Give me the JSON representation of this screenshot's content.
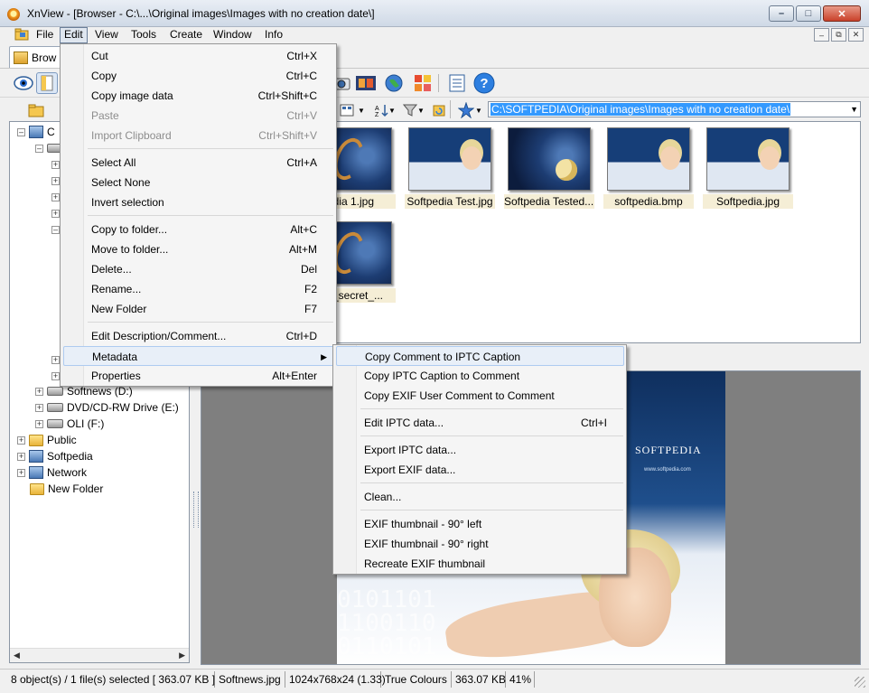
{
  "window": {
    "title": "XnView - [Browser - C:\\...\\Original images\\Images with no creation date\\]"
  },
  "menubar": {
    "items": [
      "File",
      "Edit",
      "View",
      "Tools",
      "Create",
      "Window",
      "Info"
    ]
  },
  "tab": {
    "label": "Brow"
  },
  "address": {
    "path": "C:\\SOFTPEDIA\\Original images\\Images with no creation date\\"
  },
  "tree": {
    "partial_label": "C",
    "nodes": [
      "Softnews (D:)",
      "DVD/CD-RW Drive (E:)",
      "OLI (F:)",
      "Public",
      "Softpedia",
      "Network",
      "New Folder"
    ]
  },
  "thumbnails": [
    {
      "caption": "edia 1.jpg"
    },
    {
      "caption": "Softpedia Test.jpg"
    },
    {
      "caption": "Softpedia Tested...."
    },
    {
      "caption": "softpedia.bmp"
    },
    {
      "caption": "Softpedia.jpg"
    },
    {
      "caption": "dia_secret_..."
    }
  ],
  "preview": {
    "logo": "SOFTPEDIA",
    "url": "www.softpedia.com"
  },
  "status": {
    "objects": "8 object(s) / 1 file(s) selected  [ 363.07 KB ]",
    "filename": "Softnews.jpg",
    "dims": "1024x768x24 (1.33)",
    "colours": "True Colours",
    "size": "363.07 KB",
    "zoom": "41%"
  },
  "edit_menu": {
    "items": [
      {
        "label": "Cut",
        "shortcut": "Ctrl+X"
      },
      {
        "label": "Copy",
        "shortcut": "Ctrl+C"
      },
      {
        "label": "Copy image data",
        "shortcut": "Ctrl+Shift+C"
      },
      {
        "label": "Paste",
        "shortcut": "Ctrl+V"
      },
      {
        "label": "Import Clipboard",
        "shortcut": "Ctrl+Shift+V"
      },
      {
        "label": "Select All",
        "shortcut": "Ctrl+A"
      },
      {
        "label": "Select None",
        "shortcut": ""
      },
      {
        "label": "Invert selection",
        "shortcut": ""
      },
      {
        "label": "Copy to folder...",
        "shortcut": "Alt+C"
      },
      {
        "label": "Move to folder...",
        "shortcut": "Alt+M"
      },
      {
        "label": "Delete...",
        "shortcut": "Del"
      },
      {
        "label": "Rename...",
        "shortcut": "F2"
      },
      {
        "label": "New Folder",
        "shortcut": "F7"
      },
      {
        "label": "Edit Description/Comment...",
        "shortcut": "Ctrl+D"
      },
      {
        "label": "Metadata",
        "shortcut": ""
      },
      {
        "label": "Properties",
        "shortcut": "Alt+Enter"
      }
    ]
  },
  "metadata_menu": {
    "items": [
      {
        "label": "Copy Comment to IPTC Caption",
        "shortcut": ""
      },
      {
        "label": "Copy IPTC Caption to Comment",
        "shortcut": ""
      },
      {
        "label": "Copy EXIF User Comment to Comment",
        "shortcut": ""
      },
      {
        "label": "Edit IPTC data...",
        "shortcut": "Ctrl+I"
      },
      {
        "label": "Export IPTC data...",
        "shortcut": ""
      },
      {
        "label": "Export EXIF data...",
        "shortcut": ""
      },
      {
        "label": "Clean...",
        "shortcut": ""
      },
      {
        "label": "EXIF thumbnail - 90° left",
        "shortcut": ""
      },
      {
        "label": "EXIF thumbnail - 90° right",
        "shortcut": ""
      },
      {
        "label": "Recreate EXIF thumbnail",
        "shortcut": ""
      }
    ]
  },
  "colors": {
    "selection": "#3399ff",
    "menu_highlight": "#e8eff8",
    "caption_bg": "#f5eed6"
  }
}
